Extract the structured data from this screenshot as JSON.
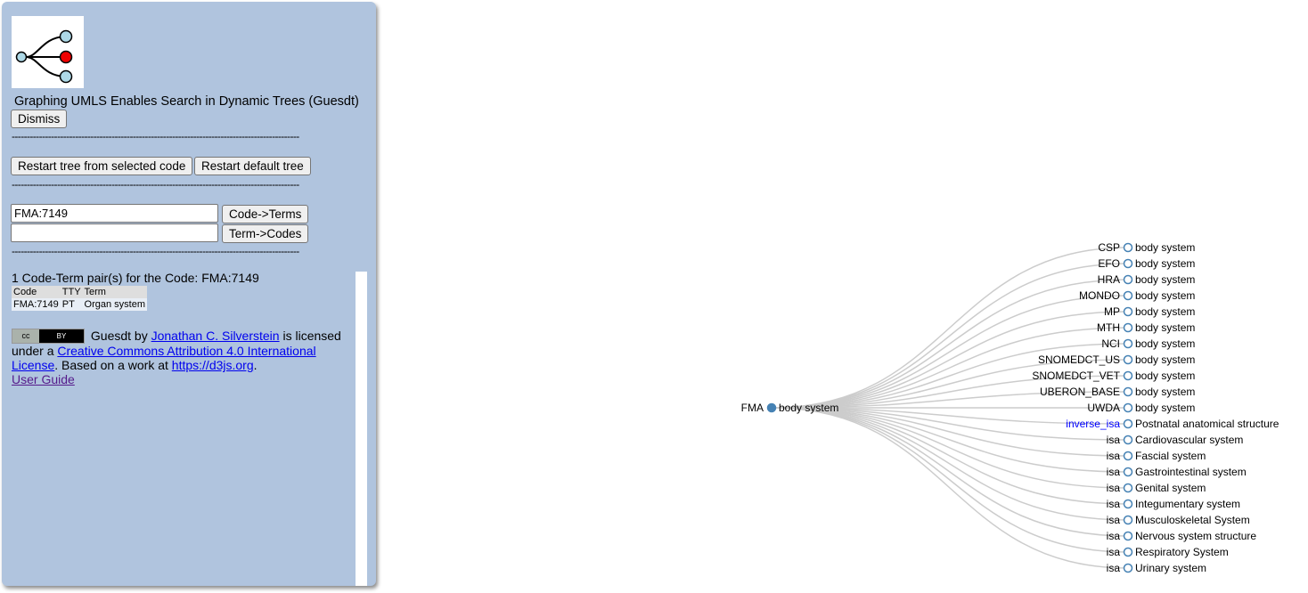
{
  "panel": {
    "title": "Graphing UMLS Enables Search in Dynamic Trees (Guesdt)",
    "dismiss_label": "Dismiss",
    "separator": "-----------------------------------------------------------------------------------------------",
    "restart_selected_label": "Restart tree from selected code",
    "restart_default_label": "Restart default tree",
    "code_input_value": "FMA:7149",
    "term_input_value": "",
    "code_to_terms_label": "Code->Terms",
    "term_to_codes_label": "Term->Codes",
    "result_summary": "1 Code-Term pair(s) for the Code: FMA:7149",
    "table_headers": [
      "Code",
      "TTY",
      "Term"
    ],
    "table_rows": [
      [
        "FMA:7149",
        "PT",
        "Organ system"
      ]
    ],
    "license": {
      "badge_left": "cc",
      "badge_right": "BY",
      "prefix": "Guesdt by",
      "author": "Jonathan C. Silverstein",
      "mid": "is licensed under a",
      "license_name": "Creative Commons Attribution 4.0 International License",
      "based": ". Based on a work at",
      "based_link": "https://d3js.org",
      "end": ".",
      "user_guide": "User Guide"
    }
  },
  "tree": {
    "root": {
      "source": "FMA",
      "label": "body system"
    },
    "children": [
      {
        "rel": "CSP",
        "label": "body system",
        "highlight": false
      },
      {
        "rel": "EFO",
        "label": "body system",
        "highlight": false
      },
      {
        "rel": "HRA",
        "label": "body system",
        "highlight": false
      },
      {
        "rel": "MONDO",
        "label": "body system",
        "highlight": false
      },
      {
        "rel": "MP",
        "label": "body system",
        "highlight": false
      },
      {
        "rel": "MTH",
        "label": "body system",
        "highlight": false
      },
      {
        "rel": "NCI",
        "label": "body system",
        "highlight": false
      },
      {
        "rel": "SNOMEDCT_US",
        "label": "body system",
        "highlight": false
      },
      {
        "rel": "SNOMEDCT_VET",
        "label": "body system",
        "highlight": false
      },
      {
        "rel": "UBERON_BASE",
        "label": "body system",
        "highlight": false
      },
      {
        "rel": "UWDA",
        "label": "body system",
        "highlight": false
      },
      {
        "rel": "inverse_isa",
        "label": "Postnatal anatomical structure",
        "highlight": true
      },
      {
        "rel": "isa",
        "label": "Cardiovascular system",
        "highlight": false
      },
      {
        "rel": "isa",
        "label": "Fascial system",
        "highlight": false
      },
      {
        "rel": "isa",
        "label": "Gastrointestinal system",
        "highlight": false
      },
      {
        "rel": "isa",
        "label": "Genital system",
        "highlight": false
      },
      {
        "rel": "isa",
        "label": "Integumentary system",
        "highlight": false
      },
      {
        "rel": "isa",
        "label": "Musculoskeletal System",
        "highlight": false
      },
      {
        "rel": "isa",
        "label": "Nervous system structure",
        "highlight": false
      },
      {
        "rel": "isa",
        "label": "Respiratory System",
        "highlight": false
      },
      {
        "rel": "isa",
        "label": "Urinary system",
        "highlight": false
      }
    ]
  },
  "colors": {
    "panel_bg": "#b0c4de",
    "link_stroke": "#cccccc",
    "node_stroke": "#4682b4",
    "root_fill": "#4682b4",
    "highlight_text": "#0000ff",
    "logo_red": "#ee0000",
    "logo_node": "#add8e6"
  }
}
